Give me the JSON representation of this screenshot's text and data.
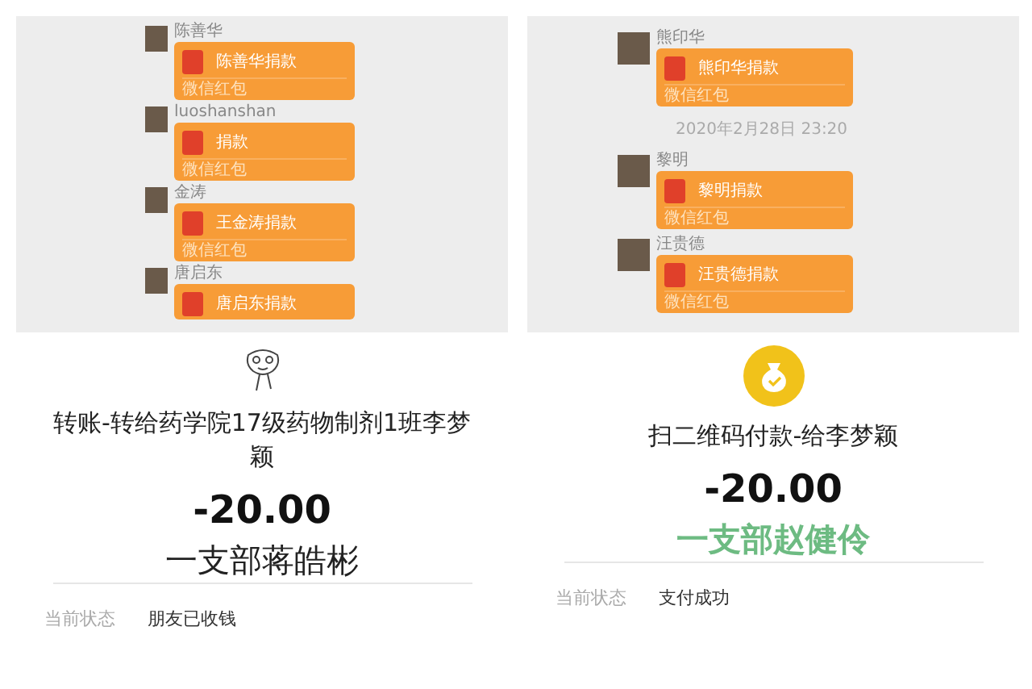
{
  "panels": [
    {
      "chat": [
        {
          "kind": "message",
          "sender": "陈善华",
          "text": "陈善华捐款",
          "footer": "微信红包"
        },
        {
          "kind": "message",
          "sender": "luoshanshan",
          "text": "捐款",
          "footer": "微信红包"
        },
        {
          "kind": "message",
          "sender": "金涛",
          "text": "王金涛捐款",
          "footer": "微信红包"
        },
        {
          "kind": "message",
          "sender": "唐启东",
          "text": "唐启东捐款"
        }
      ],
      "detail": {
        "kind": "transfer",
        "title": "转账-转给药学院17级药物制剂1班李梦颖",
        "amount": "-20.00",
        "note": "一支部蒋皓彬",
        "status_label": "当前状态",
        "status": "朋友已收钱"
      }
    },
    {
      "chat": [
        {
          "kind": "message",
          "sender": "熊印华",
          "text": "熊印华捐款",
          "footer": "微信红包"
        },
        {
          "kind": "time",
          "text": "2020年2月28日 23:20"
        },
        {
          "kind": "message",
          "sender": "黎明",
          "text": "黎明捐款",
          "footer": "微信红包"
        },
        {
          "kind": "message",
          "sender": "汪贵德",
          "text": "汪贵德捐款",
          "footer": "微信红包"
        }
      ],
      "detail": {
        "kind": "qr_payment",
        "title": "扫二维码付款-给李梦颖",
        "amount": "-20.00",
        "note": "一支部赵健伶",
        "status_label": "当前状态",
        "status": "支付成功"
      }
    }
  ]
}
